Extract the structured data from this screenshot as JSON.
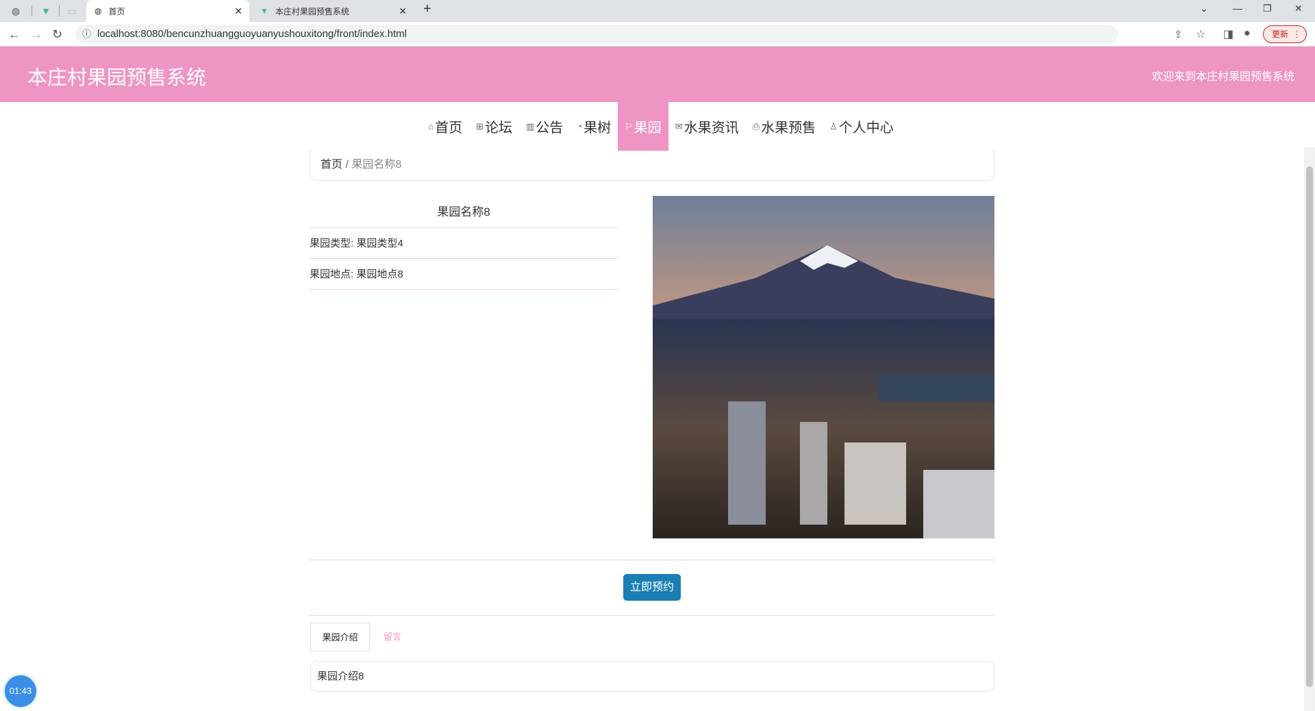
{
  "browser": {
    "tabs": [
      {
        "label": "首页",
        "icon": "globe-icon",
        "active": true
      },
      {
        "label": "本庄村果园预售系统",
        "icon": "vue-icon",
        "active": false
      }
    ],
    "url": "localhost:8080/bencunzhuangguoyuanyushouxitong/front/index.html",
    "update_label": "更新"
  },
  "header": {
    "title": "本庄村果园预售系统",
    "welcome": "欢迎来到本庄村果园预售系统",
    "color": "#ef95c4"
  },
  "menu": [
    {
      "label": "首页",
      "icon": "home-icon"
    },
    {
      "label": "论坛",
      "icon": "gift-icon"
    },
    {
      "label": "公告",
      "icon": "grid-icon"
    },
    {
      "label": "果树",
      "icon": "gauge-icon"
    },
    {
      "label": "果园",
      "icon": "flag-icon",
      "active": true
    },
    {
      "label": "水果资讯",
      "icon": "mail-icon"
    },
    {
      "label": "水果预售",
      "icon": "printer-icon"
    },
    {
      "label": "个人中心",
      "icon": "user-icon"
    }
  ],
  "breadcrumb": {
    "home": "首页",
    "sep": "/",
    "current": "果园名称8"
  },
  "detail": {
    "name": "果园名称8",
    "type_row": "果园类型: 果园类型4",
    "location_row": "果园地点: 果园地点8",
    "image_alt": "mountain-city-photo"
  },
  "actions": {
    "reserve_label": "立即预约",
    "button_color": "#1b7fb3"
  },
  "tabs": [
    {
      "label": "果园介绍",
      "active": true
    },
    {
      "label": "留言",
      "active": false
    }
  ],
  "intro": "果园介绍8",
  "timer": "01:43"
}
